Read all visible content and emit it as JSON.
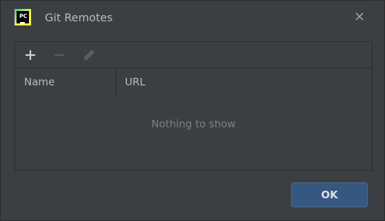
{
  "window": {
    "title": "Git Remotes",
    "logo_text": "PC"
  },
  "toolbar": {
    "add_icon": "plus-icon",
    "remove_icon": "minus-icon",
    "edit_icon": "pencil-icon"
  },
  "table": {
    "columns": [
      "Name",
      "URL"
    ],
    "empty_text": "Nothing to show"
  },
  "footer": {
    "ok_label": "OK"
  },
  "colors": {
    "background": "#3c3f41",
    "primary_button": "#365880",
    "text": "#bbbbbb",
    "muted_text": "#7f7f7f"
  }
}
